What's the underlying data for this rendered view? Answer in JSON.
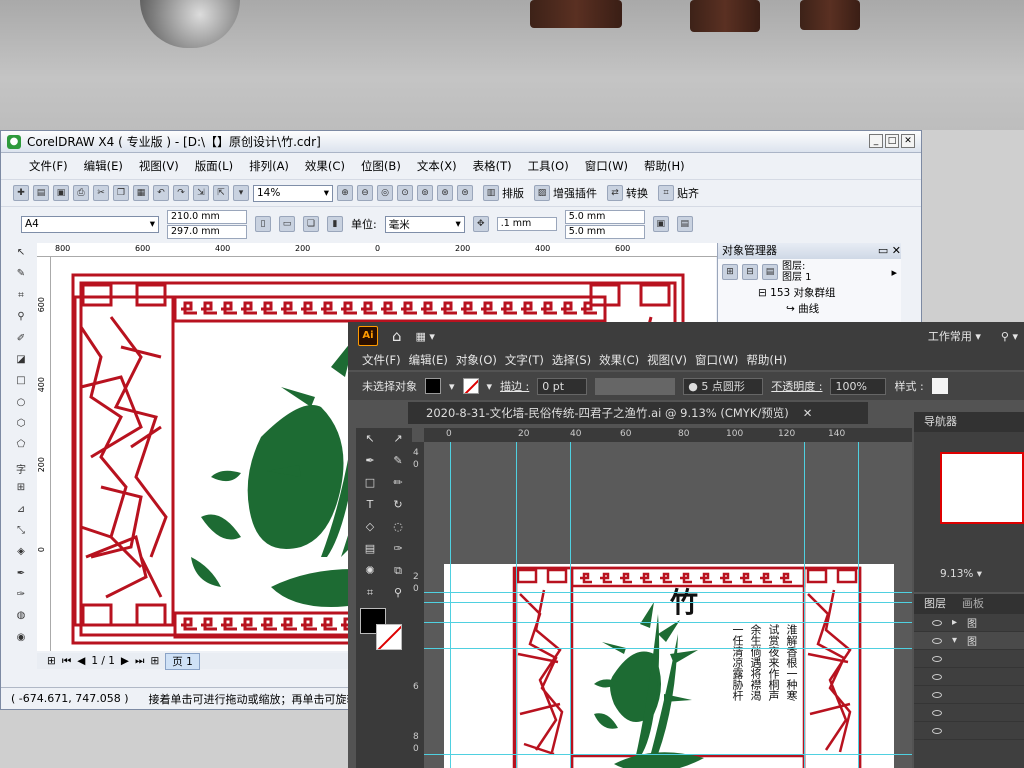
{
  "corel": {
    "title": "CorelDRAW X4 ( 专业版 ) - [D:\\【】原创设计\\竹.cdr]",
    "menu": [
      "文件(F)",
      "编辑(E)",
      "视图(V)",
      "版面(L)",
      "排列(A)",
      "效果(C)",
      "位图(B)",
      "文本(X)",
      "表格(T)",
      "工具(O)",
      "窗口(W)",
      "帮助(H)"
    ],
    "zoom": "14%",
    "toolbar_right": [
      "排版",
      "增强插件",
      "转换",
      "贴齐"
    ],
    "paper_size": "A4",
    "width": "210.0 mm",
    "height": "297.0 mm",
    "unit_label": "单位:",
    "unit": "毫米",
    "nudge": ".1 mm",
    "dup_x": "5.0 mm",
    "dup_y": "5.0 mm",
    "ruler_h": [
      "800",
      "600",
      "400",
      "200",
      "0",
      "200",
      "400",
      "600"
    ],
    "ruler_v": [
      "600",
      "400",
      "200",
      "0"
    ],
    "page_count": "1 / 1",
    "page_tab": "页 1",
    "coords": "( -674.671, 747.058 )",
    "status": "接着单击可进行拖动或缩放；再单击可旋转或倾斜",
    "obj_panel": {
      "title": "对象管理器",
      "layer": "图层:",
      "layer_value": "图层 1",
      "group": "153 对象群组",
      "curve": "曲线"
    }
  },
  "ai": {
    "logo": "Ai",
    "workspace": "工作常用",
    "menu": [
      "文件(F)",
      "编辑(E)",
      "对象(O)",
      "文字(T)",
      "选择(S)",
      "效果(C)",
      "视图(V)",
      "窗口(W)",
      "帮助(H)"
    ],
    "no_selection": "未选择对象",
    "stroke_label": "描边 :",
    "stroke_value": "0 pt",
    "brush": "5 点圆形",
    "opacity_label": "不透明度 :",
    "opacity_value": "100%",
    "style_label": "样式 :",
    "doc_tab": "2020-8-31-文化墙-民俗传统-四君子之渔竹.ai @ 9.13% (CMYK/预览)",
    "ruler_h": [
      "0",
      "20",
      "40",
      "60",
      "80",
      "100",
      "120",
      "140"
    ],
    "ruler_v": [
      "4",
      "0",
      "2",
      "0",
      "6",
      "8",
      "0"
    ],
    "navigator": "导航器",
    "zoom": "9.13%",
    "layers_tab": "图层",
    "artboards_tab": "画板",
    "layer_labels": [
      "图",
      "图"
    ],
    "artwork": {
      "title_char": "竹",
      "poem_columns": [
        "淮解香根一种寒",
        "试赏夜来作桐声",
        "余生倘遇将襟渴",
        "一任清凉露胁杆"
      ]
    }
  }
}
